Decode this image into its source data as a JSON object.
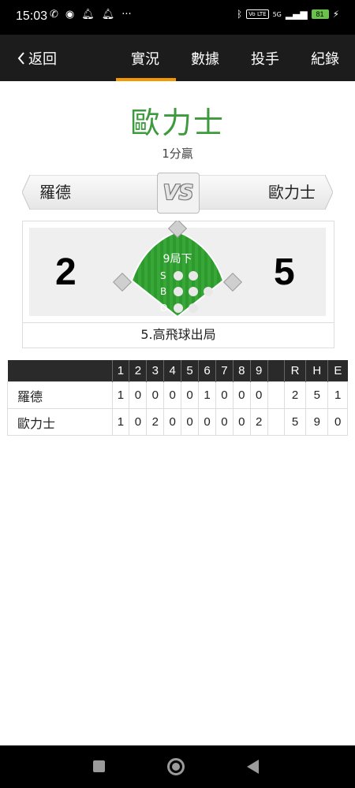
{
  "status_bar": {
    "time": "15:03",
    "battery": "81",
    "network": "5G",
    "volte": "Vo LTE"
  },
  "nav": {
    "back_label": "返回",
    "tabs": [
      {
        "label": "實況",
        "active": true
      },
      {
        "label": "數據",
        "active": false
      },
      {
        "label": "投手",
        "active": false
      },
      {
        "label": "紀錄",
        "active": false
      }
    ],
    "accent_color": "#f39800"
  },
  "game": {
    "winner": "歐力士",
    "margin_text": "1分贏",
    "away_team": "羅德",
    "home_team": "歐力士",
    "vs": "VS",
    "away_score": "2",
    "home_score": "5",
    "inning": "9局下",
    "count_labels": [
      "S",
      "B",
      "O"
    ],
    "last_play": "5.高飛球出局",
    "winner_color": "#3d9a3d"
  },
  "linescore": {
    "headers": [
      "1",
      "2",
      "3",
      "4",
      "5",
      "6",
      "7",
      "8",
      "9",
      "",
      "R",
      "H",
      "E"
    ],
    "rows": [
      {
        "team": "羅德",
        "cells": [
          "1",
          "0",
          "0",
          "0",
          "0",
          "1",
          "0",
          "0",
          "0",
          "",
          "2",
          "5",
          "1"
        ]
      },
      {
        "team": "歐力士",
        "cells": [
          "1",
          "0",
          "2",
          "0",
          "0",
          "0",
          "0",
          "0",
          "2",
          "",
          "5",
          "9",
          "0"
        ]
      }
    ]
  }
}
